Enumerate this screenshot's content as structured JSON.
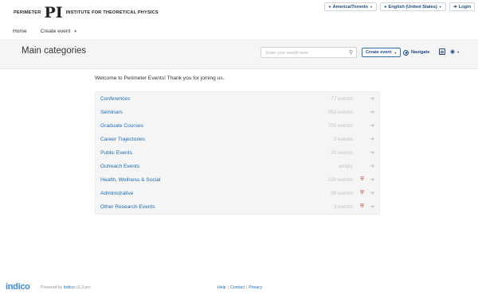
{
  "header": {
    "logo_left": "PERIMETER",
    "logo_mark": "PI",
    "logo_right": "INSTITUTE FOR THEORETICAL PHYSICS",
    "timezone": "America/Toronto",
    "language": "English (United States)",
    "login_label": "Login"
  },
  "menu": {
    "home": "Home",
    "create_event": "Create event"
  },
  "title_band": {
    "title": "Main categories",
    "search_placeholder": "Enter your search term",
    "create_event_btn": "Create event",
    "navigate_btn": "Navigate"
  },
  "welcome": "Welcome to Perimeter Events! Thank you for joining us.",
  "categories": [
    {
      "name": "Conferences",
      "count": "77 events",
      "protected": false
    },
    {
      "name": "Seminars",
      "count": "353 events",
      "protected": false
    },
    {
      "name": "Graduate Courses",
      "count": "705 events",
      "protected": false
    },
    {
      "name": "Career Trajectories",
      "count": "3 events",
      "protected": false
    },
    {
      "name": "Public Events",
      "count": "20 events",
      "protected": false
    },
    {
      "name": "Outreach Events",
      "count": "empty",
      "protected": false
    },
    {
      "name": "Health, Wellness & Social",
      "count": "150 events",
      "protected": true
    },
    {
      "name": "Administrative",
      "count": "88 events",
      "protected": true
    },
    {
      "name": "Other Research Events",
      "count": "3 events",
      "protected": true
    }
  ],
  "icons": {
    "timezone": "globe-icon",
    "language": "globe-icon",
    "login": "login-icon",
    "search": "search-icon",
    "navigate": "compass-icon",
    "calendar": "calendar-icon",
    "view": "eye-icon",
    "protected": "shield-icon",
    "go": "arrow-right-icon"
  },
  "footer": {
    "logo": "indico",
    "powered_prefix": "Powered by",
    "powered_link": "Indico",
    "version": "v3.3.pre",
    "help": "Help",
    "contact": "Contact",
    "privacy": "Privacy",
    "separator": "|"
  },
  "colors": {
    "link": "#1d6db5",
    "accent": "#1d4a86",
    "protected": "#c0392b",
    "band": "#f5f5f5"
  }
}
